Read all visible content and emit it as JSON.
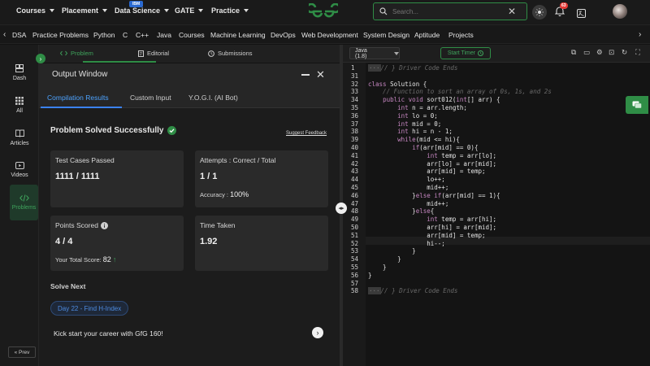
{
  "topnav": {
    "items": [
      "Courses",
      "Placement",
      "Data Science",
      "GATE",
      "Practice"
    ],
    "ibm_badge": "IBM",
    "search_placeholder": "Search...",
    "notifications": "63"
  },
  "subnav": {
    "items": [
      "DSA",
      "Practice Problems",
      "Python",
      "C",
      "C++",
      "Java",
      "Courses",
      "Machine Learning",
      "DevOps",
      "Web Development",
      "System Design",
      "Aptitude",
      "Projects"
    ]
  },
  "sidebar": {
    "items": [
      "Dash",
      "All",
      "Articles",
      "Videos",
      "Problems"
    ],
    "prev": "Prev"
  },
  "problem_tabs": [
    "Problem",
    "Editorial",
    "Submissions"
  ],
  "output": {
    "title": "Output Window",
    "tabs": [
      "Compilation Results",
      "Custom Input",
      "Y.O.G.I. (AI Bot)"
    ],
    "status": "Problem Solved Successfully",
    "feedback": "Suggest Feedback",
    "cards": {
      "test_label": "Test Cases Passed",
      "test_value": "1111 / 1111",
      "attempts_label": "Attempts : Correct / Total",
      "attempts_value": "1 / 1",
      "accuracy_label": "Accuracy : ",
      "accuracy_value": "100%",
      "points_label": "Points Scored",
      "points_value": "4 / 4",
      "total_label": "Your Total Score: ",
      "total_value": "82",
      "time_label": "Time Taken",
      "time_value": "1.92"
    },
    "solve_next": "Solve Next",
    "next_problem": "Day 22 - Find H-Index",
    "kickstart": "Kick start your career with GfG 160!"
  },
  "editor": {
    "language": "Java (1.8)",
    "timer": "Start Timer",
    "lines": [
      {
        "n": "1",
        "text": "// } Driver Code Ends"
      },
      {
        "n": "31",
        "text": ""
      },
      {
        "n": "32",
        "text": "class Solution {"
      },
      {
        "n": "33",
        "text": "    // Function to sort an array of 0s, 1s, and 2s"
      },
      {
        "n": "34",
        "text": "    public void sort012(int[] arr) {"
      },
      {
        "n": "35",
        "text": "        int n = arr.length;"
      },
      {
        "n": "36",
        "text": "        int lo = 0;"
      },
      {
        "n": "37",
        "text": "        int mid = 0;"
      },
      {
        "n": "38",
        "text": "        int hi = n - 1;"
      },
      {
        "n": "39",
        "text": "        while(mid <= hi){"
      },
      {
        "n": "40",
        "text": "            if(arr[mid] == 0){"
      },
      {
        "n": "41",
        "text": "                int temp = arr[lo];"
      },
      {
        "n": "42",
        "text": "                arr[lo] = arr[mid];"
      },
      {
        "n": "43",
        "text": "                arr[mid] = temp;"
      },
      {
        "n": "44",
        "text": "                lo++;"
      },
      {
        "n": "45",
        "text": "                mid++;"
      },
      {
        "n": "46",
        "text": "            }else if(arr[mid] == 1){"
      },
      {
        "n": "47",
        "text": "                mid++;"
      },
      {
        "n": "48",
        "text": "            }else{"
      },
      {
        "n": "49",
        "text": "                int temp = arr[hi];"
      },
      {
        "n": "50",
        "text": "                arr[hi] = arr[mid];"
      },
      {
        "n": "51",
        "text": "                arr[mid] = temp;"
      },
      {
        "n": "52",
        "text": "                hi--;"
      },
      {
        "n": "53",
        "text": "            }"
      },
      {
        "n": "54",
        "text": "        }"
      },
      {
        "n": "55",
        "text": "    }"
      },
      {
        "n": "56",
        "text": "}"
      },
      {
        "n": "57",
        "text": ""
      },
      {
        "n": "58",
        "text": "// } Driver Code Ends"
      }
    ]
  },
  "colors": {
    "brand_green": "#2f8d46",
    "accent_blue": "#3b82f6",
    "badge_red": "#e53935"
  }
}
